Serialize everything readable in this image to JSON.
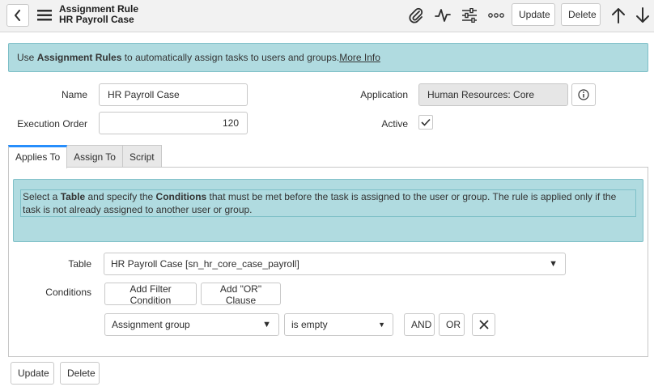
{
  "header": {
    "title": "Assignment Rule",
    "subtitle": "HR Payroll Case",
    "update_label": "Update",
    "delete_label": "Delete",
    "icons": [
      "back-icon",
      "menu-icon",
      "attachment-icon",
      "activity-icon",
      "settings-sliders-icon",
      "more-icon",
      "arrow-up-icon",
      "arrow-down-icon"
    ]
  },
  "banner": {
    "prefix": "Use ",
    "bold": "Assignment Rules",
    "suffix": " to automatically assign tasks to users and groups.",
    "link": "More Info"
  },
  "form": {
    "name_label": "Name",
    "name_value": "HR Payroll Case",
    "execution_order_label": "Execution Order",
    "execution_order_value": "120",
    "application_label": "Application",
    "application_value": "Human Resources: Core",
    "active_label": "Active",
    "active_checked": true
  },
  "tabs": [
    {
      "label": "Applies To",
      "active": true
    },
    {
      "label": "Assign To",
      "active": false
    },
    {
      "label": "Script",
      "active": false
    }
  ],
  "applies_to": {
    "note": {
      "t1": "Select a ",
      "b1": "Table",
      "t2": " and specify the ",
      "b2": "Conditions",
      "t3": " that must be met before the task is assigned to the user or group. The rule is applied only if the task is not already assigned to another user or group."
    },
    "table_label": "Table",
    "table_value": "HR Payroll Case [sn_hr_core_case_payroll]",
    "conditions_label": "Conditions",
    "add_filter_label": "Add Filter Condition",
    "add_or_label": "Add \"OR\" Clause",
    "condition_field": "Assignment group",
    "condition_operator": "is empty",
    "and_label": "AND",
    "or_label": "OR"
  },
  "footer": {
    "update_label": "Update",
    "delete_label": "Delete"
  },
  "colors": {
    "banner_bg": "#b0dbe0",
    "tab_accent": "#278efc"
  }
}
